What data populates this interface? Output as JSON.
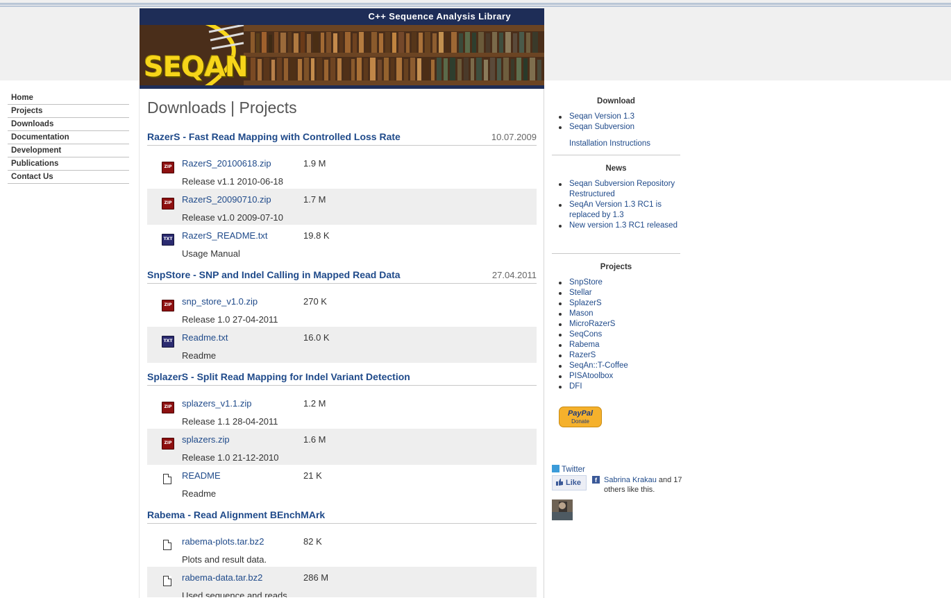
{
  "banner": {
    "title": "C++ Sequence Analysis Library",
    "logo": "SEQAN"
  },
  "nav": {
    "items": [
      {
        "label": "Home"
      },
      {
        "label": "Projects"
      },
      {
        "label": "Downloads"
      },
      {
        "label": "Documentation"
      },
      {
        "label": "Development"
      },
      {
        "label": "Publications"
      },
      {
        "label": "Contact Us"
      }
    ]
  },
  "main": {
    "title": "Downloads | Projects",
    "sections": [
      {
        "title": "RazerS - Fast Read Mapping with Controlled Loss Rate",
        "date": "10.07.2009",
        "files": [
          {
            "name": "RazerS_20100618.zip",
            "size": "1.9 M",
            "desc": "Release v1.1 2010-06-18",
            "icon": "zip-icon"
          },
          {
            "name": "RazerS_20090710.zip",
            "size": "1.7 M",
            "desc": "Release v1.0 2009-07-10",
            "icon": "zip-icon"
          },
          {
            "name": "RazerS_README.txt",
            "size": "19.8 K",
            "desc": "Usage Manual",
            "icon": "txt-icon"
          }
        ]
      },
      {
        "title": "SnpStore - SNP and Indel Calling in Mapped Read Data",
        "date": "27.04.2011",
        "files": [
          {
            "name": "snp_store_v1.0.zip",
            "size": "270 K",
            "desc": "Release 1.0 27-04-2011",
            "icon": "zip-icon"
          },
          {
            "name": "Readme.txt",
            "size": "16.0 K",
            "desc": "Readme",
            "icon": "txt-icon"
          }
        ]
      },
      {
        "title": "SplazerS - Split Read Mapping for Indel Variant Detection",
        "date": "",
        "files": [
          {
            "name": "splazers_v1.1.zip",
            "size": "1.2 M",
            "desc": "Release 1.1 28-04-2011",
            "icon": "zip-icon"
          },
          {
            "name": "splazers.zip",
            "size": "1.6 M",
            "desc": "Release 1.0 21-12-2010",
            "icon": "zip-icon"
          },
          {
            "name": "README",
            "size": "21 K",
            "desc": "Readme",
            "icon": "document-icon"
          }
        ]
      },
      {
        "title": "Rabema - Read Alignment BEnchMArk",
        "date": "",
        "files": [
          {
            "name": "rabema-plots.tar.bz2",
            "size": "82 K",
            "desc": "Plots and result data.",
            "icon": "document-icon"
          },
          {
            "name": "rabema-data.tar.bz2",
            "size": "286 M",
            "desc": "Used sequence and reads",
            "icon": "document-icon"
          }
        ]
      }
    ]
  },
  "sidebar": {
    "download": {
      "heading": "Download",
      "items": [
        "Seqan Version 1.3",
        "Seqan Subversion"
      ],
      "extra": "Installation Instructions"
    },
    "news": {
      "heading": "News",
      "items": [
        "Seqan Subversion Repository Restructured",
        "SeqAn Version 1.3 RC1 is replaced by 1.3",
        "New version 1.3 RC1 released"
      ]
    },
    "projects": {
      "heading": "Projects",
      "items": [
        "SnpStore",
        "Stellar",
        "SplazerS",
        "Mason",
        "MicroRazerS",
        "SeqCons",
        "Rabema",
        "RazerS",
        "SeqAn::T-Coffee",
        "PISAtoolbox",
        "DFI"
      ]
    },
    "paypal": {
      "brand": "PayPal",
      "label": "Donate"
    },
    "twitter": "Twitter",
    "like": "Like",
    "fb_name": "Sabrina Krakau",
    "fb_text": "and 17 others like this."
  }
}
